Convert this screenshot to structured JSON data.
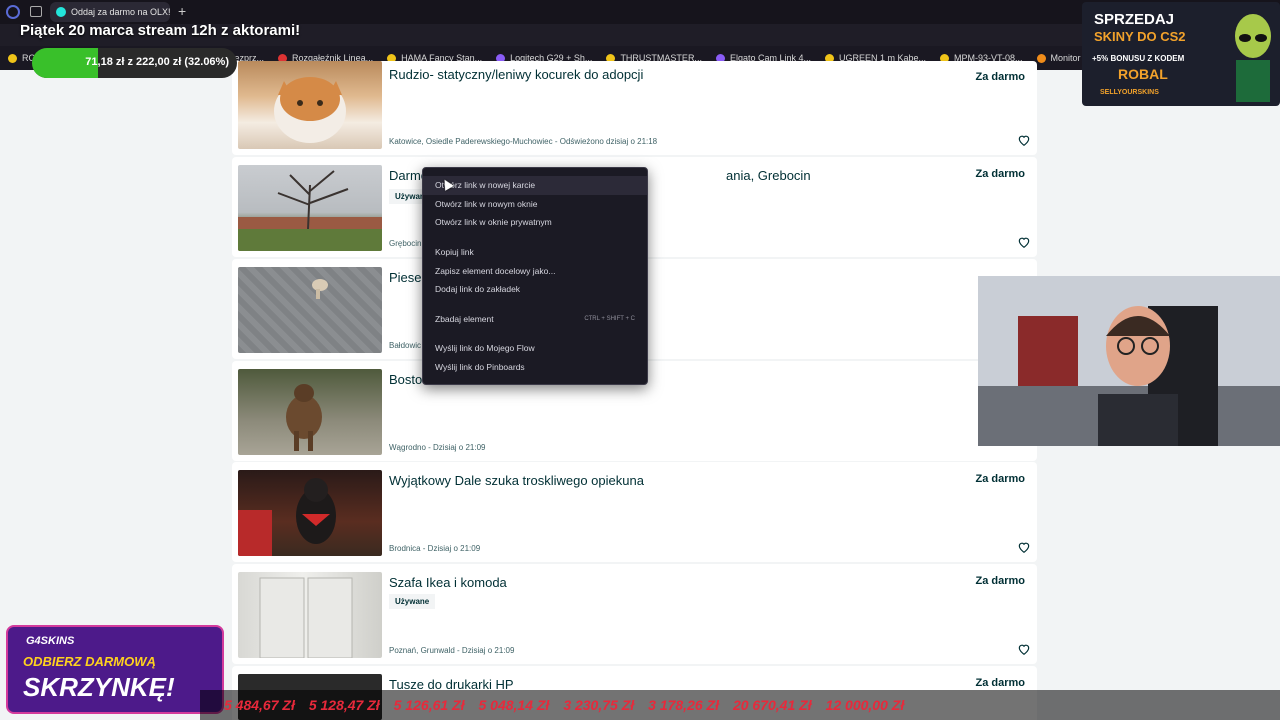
{
  "browser": {
    "tab_title": "Oddaj za darmo na OLX! D",
    "new_tab": "+",
    "bookmarks": [
      {
        "label": "RO",
        "icon": "yellow-circle-icon"
      },
      {
        "label": "chawki bezprz...",
        "icon": "page-icon"
      },
      {
        "label": "Rozgałęźnik Linea...",
        "icon": "red-logo-icon"
      },
      {
        "label": "HAMA Fancy Stan...",
        "icon": "yellow-circle-icon"
      },
      {
        "label": "Logitech G29 + Sh...",
        "icon": "purple-logo-icon"
      },
      {
        "label": "THRUSTMASTER...",
        "icon": "yellow-circle-icon"
      },
      {
        "label": "Elgato Cam Link 4...",
        "icon": "purple-logo-icon"
      },
      {
        "label": "UGREEN 1 m Kabe...",
        "icon": "yellow-circle-icon"
      },
      {
        "label": "MPM-93-VT-08...",
        "icon": "yellow-circle-icon"
      },
      {
        "label": "Monitor",
        "icon": "orange-circle-icon"
      }
    ]
  },
  "stream": {
    "title": "Piątek 20 marca stream 12h z aktorami!",
    "goal_text": "71,18 zł z 222,00 zł (32.06%)",
    "goal_fraction": 0.3206
  },
  "listings": [
    {
      "title": "Rudzio- statyczny/leniwy kocurek do adopcji",
      "badge": "",
      "price": "Za darmo",
      "location": "Katowice, Osiedle Paderewskiego-Muchowiec - Odświeżono dzisiaj o 21:18"
    },
    {
      "title": "Darmo",
      "title_tail": "ania, Grebocin",
      "badge": "Używane",
      "price": "Za darmo",
      "location": "Grębocin"
    },
    {
      "title": "Piesek",
      "badge": "",
      "price": "",
      "location": "Bałdowic"
    },
    {
      "title": "Bosto",
      "badge": "",
      "price": "",
      "location": "Wągrodno - Dzisiaj o 21:09"
    },
    {
      "title": "Wyjątkowy Dale szuka troskliwego opiekuna",
      "badge": "",
      "price": "Za darmo",
      "location": "Brodnica - Dzisiaj o 21:09"
    },
    {
      "title": "Szafa Ikea i komoda",
      "badge": "Używane",
      "price": "Za darmo",
      "location": "Poznań, Grunwald - Dzisiaj o 21:09"
    },
    {
      "title": "Tusze do drukarki HP",
      "badge": "",
      "price": "Za darmo",
      "location": ""
    }
  ],
  "context_menu": {
    "items": [
      {
        "label": "Otwórz link w nowej karcie",
        "shortcut": ""
      },
      {
        "label": "Otwórz link w nowym oknie",
        "shortcut": ""
      },
      {
        "label": "Otwórz link w oknie prywatnym",
        "shortcut": ""
      },
      {
        "label": "Kopiuj link",
        "shortcut": ""
      },
      {
        "label": "Zapisz element docelowy jako...",
        "shortcut": ""
      },
      {
        "label": "Dodaj link do zakładek",
        "shortcut": ""
      },
      {
        "label": "Zbadaj element",
        "shortcut": "CTRL + SHIFT + C"
      },
      {
        "label": "Wyślij link do Mojego Flow",
        "shortcut": ""
      },
      {
        "label": "Wyślij link do Pinboards",
        "shortcut": ""
      }
    ]
  },
  "ads": {
    "top": {
      "line1": "SPRZEDAJ",
      "line2": "SKINY DO CS2",
      "line3": "+5% BONUSU Z KODEM",
      "code": "ROBAL",
      "brand": "SELLYOURSKINS"
    },
    "bottom": {
      "brand": "G4SKINS",
      "line1": "ODBIERZ DARMOWĄ",
      "line2": "SKRZYNKĘ!"
    }
  },
  "ticker": [
    {
      "name": "",
      "amount": "5 484,67 Zł"
    },
    {
      "name": "",
      "amount": "5 128,47 Zł"
    },
    {
      "name": "",
      "amount": "5 126,61 Zł"
    },
    {
      "name": "",
      "amount": "5 048,14 Zł"
    },
    {
      "name": "",
      "amount": "3 230,75 Zł"
    },
    {
      "name": "",
      "amount": "3 178,26 Zł"
    },
    {
      "name": "",
      "amount": "20 670,41 Zł"
    },
    {
      "name": "",
      "amount": "12 000,00 Zł"
    }
  ],
  "colors": {
    "olx_teal": "#23e5db",
    "olx_dark": "#002f34",
    "ticker_red": "#e8293b",
    "goal_green": "#39c02a"
  }
}
